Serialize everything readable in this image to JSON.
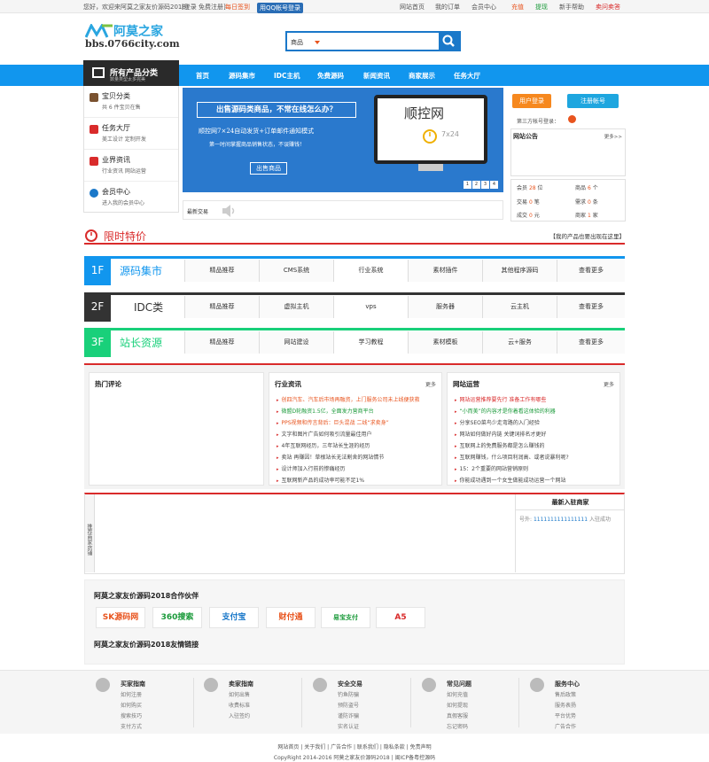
{
  "topbar": {
    "welcome": "您好，欢迎来阿莫之家友价源码2018!",
    "login": "[登录",
    "register": "免费注册]",
    "signin": "每日签到",
    "qq": "用QQ帐号登录",
    "links": [
      "网站首页",
      "我的订单",
      "会员中心",
      "充值",
      "提现",
      "新手帮助",
      "卖问卖答"
    ]
  },
  "header": {
    "logo_text": "阿莫之家",
    "logo_url": "bbs.0766city.com",
    "search_category": "商品"
  },
  "nav": {
    "all_category": "所有产品分类",
    "all_category_sub": "数量类型太多完美",
    "items": [
      "首页",
      "源码集市",
      "IDC主机",
      "免费源码",
      "新闻资讯",
      "商家展示",
      "任务大厅"
    ]
  },
  "sidebar": [
    {
      "title": "宝贝分类",
      "desc": "共 6 件宝贝在售",
      "color": "#7a5230"
    },
    {
      "title": "任务大厅",
      "desc": "美工设计   定制开发",
      "color": "#d92b2b"
    },
    {
      "title": "业界资讯",
      "desc": "行业资讯   网站运营",
      "color": "#d92b2b"
    },
    {
      "title": "会员中心",
      "desc": "进入我的会员中心",
      "color": "#1a78c9"
    }
  ],
  "banner": {
    "title": "出售源码类商品，不常在线怎么办？",
    "line1": "顺控网7×24自动发货+订单邮件通知模式",
    "line2": "第一时间掌握商品销售状态，不误赚钱！",
    "button": "出售商品",
    "brand": "顺控网",
    "brand_sub": "7x24",
    "pages": [
      "1",
      "2",
      "3",
      "4"
    ]
  },
  "ticker": {
    "label": "最新交易"
  },
  "account": {
    "login": "用户登录",
    "register": "注册帐号",
    "third": "第三方帐号登录：",
    "notice_title": "网站公告",
    "notice_more": "更多>>"
  },
  "stats": [
    {
      "label": "会员",
      "value": "28",
      "unit": "位"
    },
    {
      "label": "商品",
      "value": "6",
      "unit": "个"
    },
    {
      "label": "交易",
      "value": "0",
      "unit": "笔"
    },
    {
      "label": "需求",
      "value": "0",
      "unit": "条"
    },
    {
      "label": "成交",
      "value": "0",
      "unit": "元"
    },
    {
      "label": "商家",
      "value": "1",
      "unit": "家"
    }
  ],
  "special": {
    "title": "限时特价",
    "right": "【我的产品也要出现在这里】"
  },
  "floors": [
    {
      "num": "1F",
      "name": "源码集市",
      "color": "#1196ee",
      "tabs": [
        "精品推荐",
        "CMS系统",
        "行业系统",
        "素材插件",
        "其他程序源码",
        "查看更多"
      ]
    },
    {
      "num": "2F",
      "name": "IDC类",
      "color": "#333333",
      "tabs": [
        "精品推荐",
        "虚拟主机",
        "vps",
        "服务器",
        "云主机",
        "查看更多"
      ]
    },
    {
      "num": "3F",
      "name": "站长资源",
      "color": "#19d07a",
      "tabs": [
        "精品推荐",
        "网站建设",
        "学习教程",
        "素材模板",
        "云+服务",
        "查看更多"
      ]
    }
  ],
  "boxes": {
    "hot": {
      "title": "热门评论"
    },
    "industry": {
      "title": "行业资讯",
      "more": "更多",
      "items": [
        {
          "t": "创四汽车、汽车后市场再融资，上门服务公司未上线便获救",
          "c": "#e8541e"
        },
        {
          "t": "微盟D轮融资1.5亿，全面发力营商平台",
          "c": "#1a9a3a"
        },
        {
          "t": "PPS视频和传言背后：巨头混战 二线“求卖身”",
          "c": "#e8541e"
        },
        {
          "t": "文字和图片广告如何吸引流量最佳用户",
          "c": "#444444"
        },
        {
          "t": "4年互联网经历，三年站长生涯的经历",
          "c": "#444444"
        },
        {
          "t": "卖站 再赚因！草根站长无法割舍的网站情节",
          "c": "#444444"
        },
        {
          "t": "设计师加入行前的惨痛经历",
          "c": "#444444"
        },
        {
          "t": "互联网新产品的成功率可能不足1%",
          "c": "#444444"
        }
      ]
    },
    "ops": {
      "title": "网站运营",
      "more": "更多",
      "items": [
        {
          "t": "网站运营推荐要先行 准备工作有哪些",
          "c": "#d92b2b"
        },
        {
          "t": "“小而美”的内容才是你着看这体验的利器",
          "c": "#1a9a3a"
        },
        {
          "t": "分享SEO菜鸟少走弯路的入门经验",
          "c": "#444444"
        },
        {
          "t": "网站如何做好内链 关键词排名才更好",
          "c": "#444444"
        },
        {
          "t": "互联网上的免费服务都是怎么赚钱的",
          "c": "#444444"
        },
        {
          "t": "互联网赚钱，什么项目利润高、或者说暴利呢?",
          "c": "#444444"
        },
        {
          "t": "15：2个重要的网站营销原则",
          "c": "#444444"
        },
        {
          "t": "你能成功遇到一个女生做能成功运营一个网站",
          "c": "#444444"
        }
      ]
    }
  },
  "shops": {
    "vertical": "推荐商家店铺",
    "title": "最新入驻商家",
    "record_prefix": "号外:",
    "record_user": "1111111111111111",
    "record_suffix": "入驻成功"
  },
  "partners": {
    "title": "阿莫之家友价源码2018合作伙伴",
    "links_title": "阿莫之家友价源码2018友情链接",
    "logos": [
      {
        "text": "SK源码网",
        "color": "#e8541e"
      },
      {
        "text": "360搜索",
        "color": "#1a9a3a"
      },
      {
        "text": "支付宝",
        "color": "#1a78c9"
      },
      {
        "text": "财付通",
        "color": "#e8541e"
      },
      {
        "text": "易宝支付",
        "color": "#1a9a3a"
      },
      {
        "text": "A5",
        "color": "#d92b2b"
      }
    ]
  },
  "footer": {
    "cols": [
      {
        "title": "买家指南",
        "items": [
          "如何注册",
          "如何购买",
          "搜索技巧",
          "支付方式"
        ]
      },
      {
        "title": "卖家指南",
        "items": [
          "如何出售",
          "收费标准",
          "入驻签约"
        ]
      },
      {
        "title": "安全交易",
        "items": [
          "钓鱼防骗",
          "预防盗号",
          "谨防诈骗",
          "实名认证"
        ]
      },
      {
        "title": "常见问题",
        "items": [
          "如何充值",
          "如何提现",
          "真假客服",
          "忘记密码"
        ]
      },
      {
        "title": "服务中心",
        "items": [
          "售后政策",
          "服务表扬",
          "平台优势",
          "广告合作"
        ]
      }
    ],
    "links": "网站首页 | 关于我们 | 广告合作 | 联系我们 | 隐私条款 | 免责声明",
    "copyright": "CopyRight 2014-2016 阿莫之家友价源码2018 | 闽ICP备粤控源码"
  }
}
